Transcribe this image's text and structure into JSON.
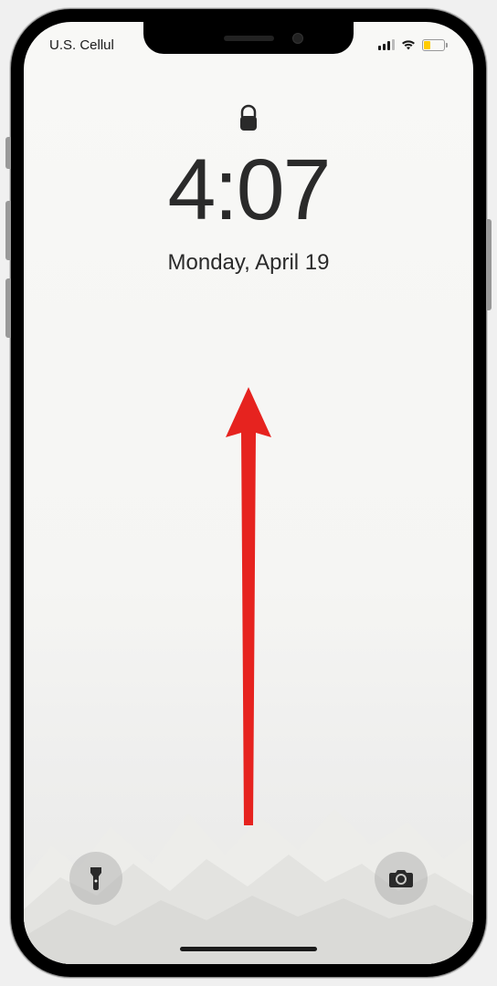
{
  "status": {
    "carrier": "U.S. Cellul",
    "signal_bars": 3,
    "wifi": true,
    "battery_low_power": true
  },
  "lockscreen": {
    "time": "4:07",
    "date": "Monday, April 19"
  },
  "annotation": {
    "type": "swipe-up-arrow",
    "color": "#e6231f"
  },
  "colors": {
    "text_dark": "#2a2a2a",
    "battery_yellow": "#ffcc00",
    "arrow_red": "#e6231f"
  }
}
